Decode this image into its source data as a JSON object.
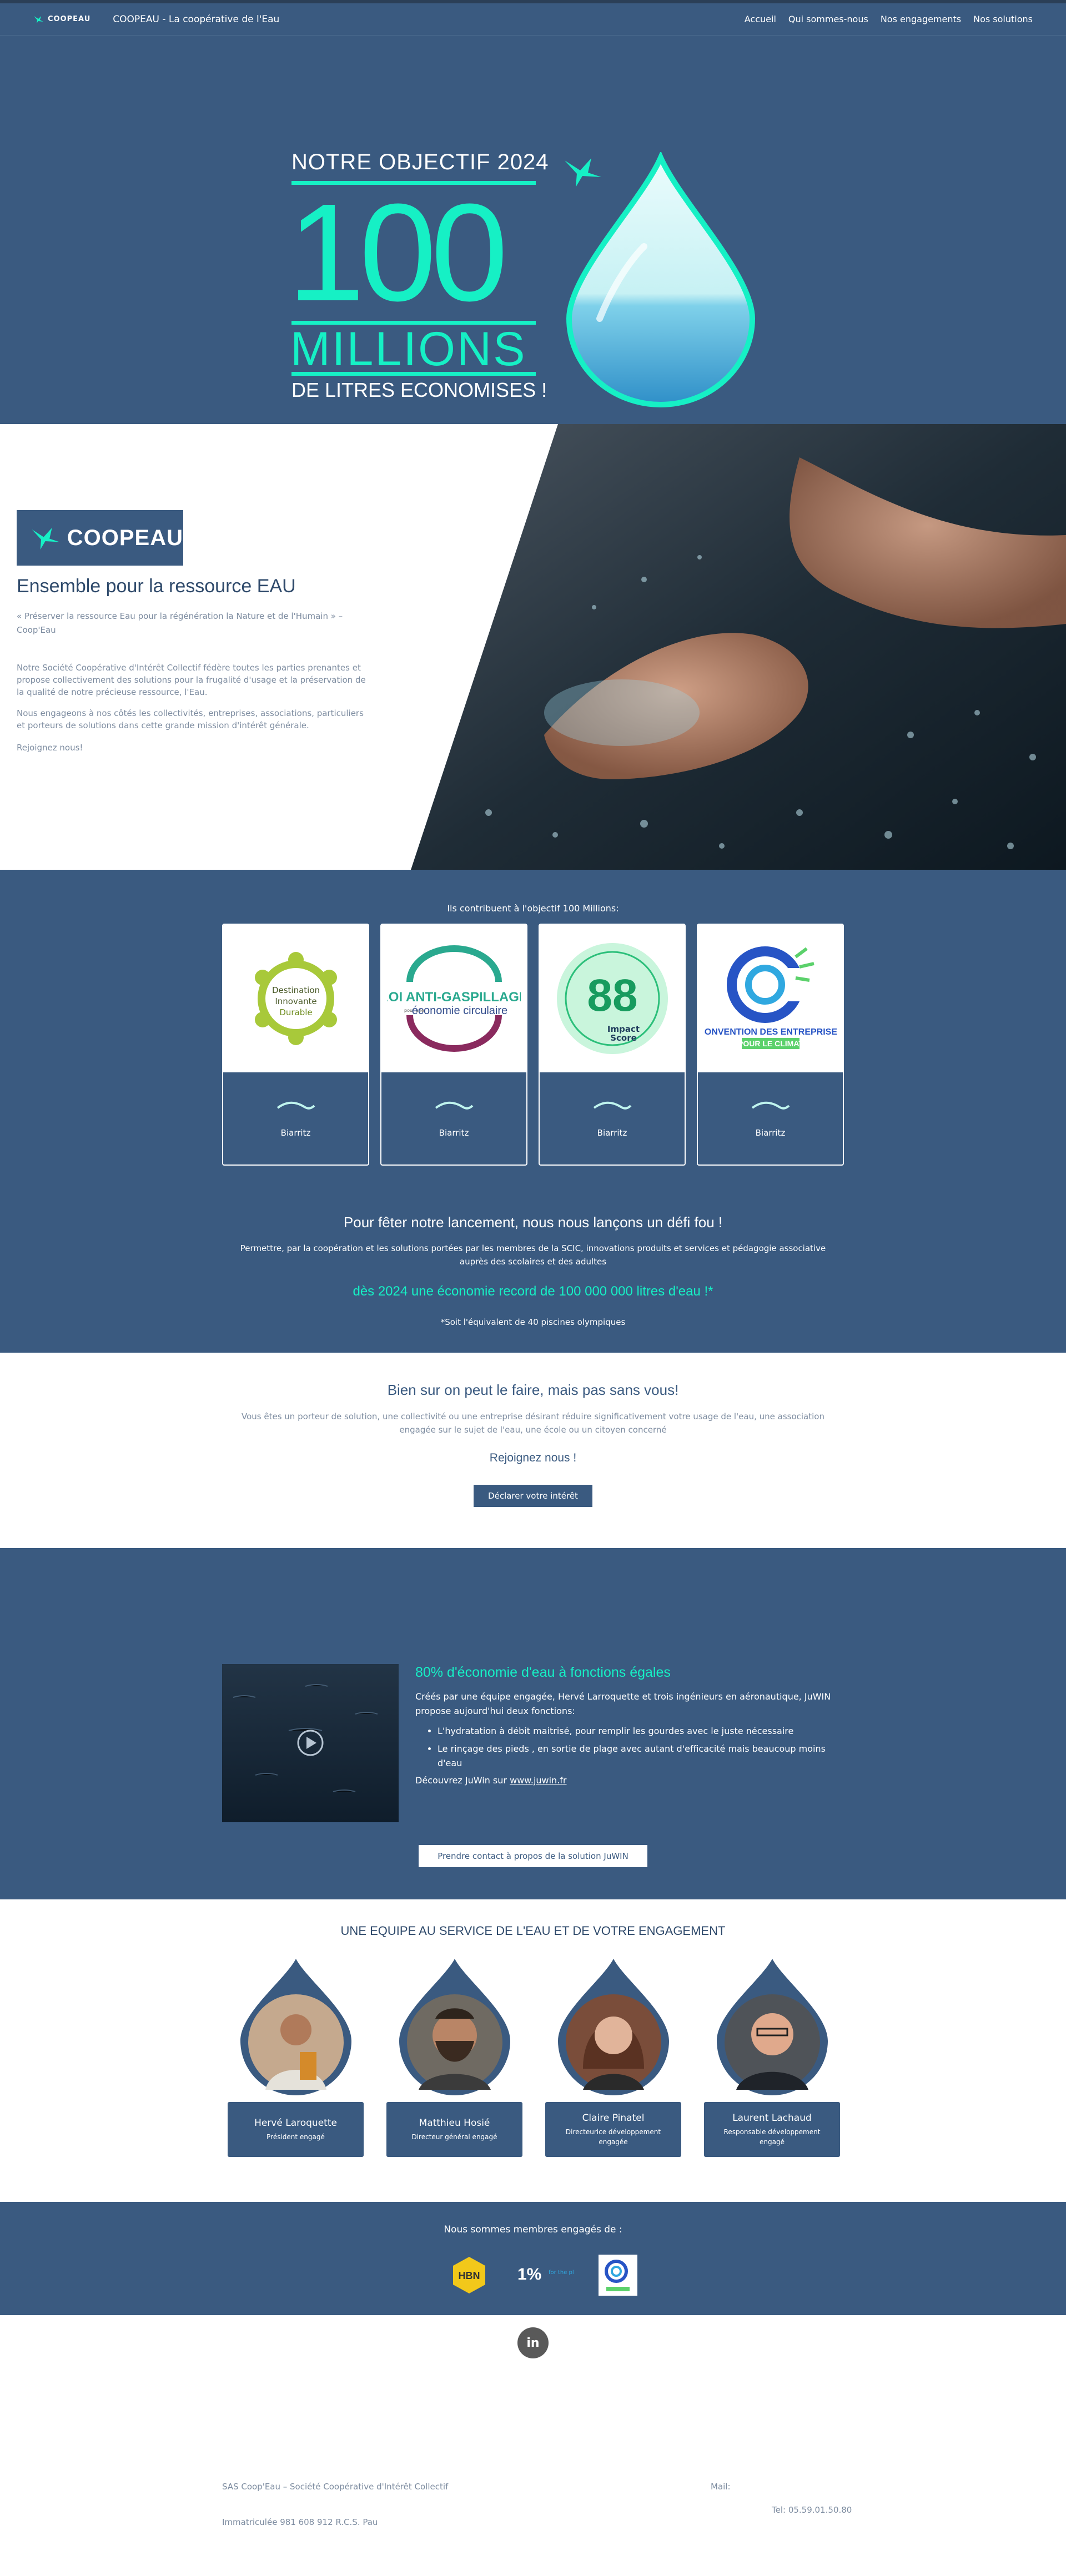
{
  "header": {
    "logo_text": "COOPEAU",
    "site_title": "COOPEAU - La coopérative de l'Eau",
    "menu": [
      "Accueil",
      "Qui sommes-nous",
      "Nos engagements",
      "Nos solutions"
    ]
  },
  "hero": {
    "objective": "NOTRE OBJECTIF 2024",
    "number": "100",
    "unit": "MILLIONS",
    "subtitle": "DE LITRES ECONOMISES !"
  },
  "ensemble": {
    "badge": "COOPEAU",
    "title": "Ensemble pour la ressource EAU",
    "quote": "« Préserver la ressource Eau pour la régénération la Nature et de l'Humain » – Coop'Eau",
    "p1": "Notre Société Coopérative d'Intérêt Collectif fédère toutes les parties prenantes et propose collectivement des solutions pour la frugalité d'usage et la préservation de la qualité de notre précieuse ressource, l'Eau.",
    "p2": "Nous engageons à nos côtés les collectivités, entreprises, associations, particuliers et porteurs de solutions dans cette grande mission d'intérêt générale.",
    "join": "Rejoignez nous!"
  },
  "contrib": {
    "title": "Ils contribuent à l'objectif 100 Millions:",
    "cards": [
      {
        "logo_line1": "Destination",
        "logo_line2": "Innovante",
        "logo_line3": "Durable",
        "city": "Biarritz"
      },
      {
        "logo_line1": "LOI ANTI-GASPILLAGE",
        "logo_line2": "économie circulaire",
        "logo_line3": "pour une",
        "city": "Biarritz"
      },
      {
        "logo_line1": "88",
        "logo_line2": "Impact",
        "logo_line3": "Score",
        "city": "Biarritz"
      },
      {
        "logo_line1": "CONVENTION DES ENTREPRISES",
        "logo_line2": "POUR LE CLIMAT",
        "logo_line3": "",
        "city": "Biarritz"
      }
    ],
    "defi_title": "Pour fêter notre lancement, nous nous lançons un défi fou !",
    "defi_text": "Permettre,  par la coopération et les solutions portées par les membres de la SCIC,  innovations produits et services et pédagogie associative auprès des scolaires et des adultes",
    "defi_goal": "dès 2024 une économie record de 100 000 000 litres d'eau !*",
    "defi_note": "*Soit l'équivalent de 40 piscines olympiques"
  },
  "join": {
    "title": "Bien sur on peut le faire, mais pas sans vous!",
    "text": "Vous êtes un porteur de solution, une collectivité ou une entreprise désirant réduire significativement votre usage de l'eau, une association engagée sur le sujet de l'eau, une école ou un citoyen concerné",
    "cta": "Rejoignez nous !",
    "button": "Déclarer votre intérêt"
  },
  "juwin": {
    "heading": "80% d'économie d'eau à fonctions égales",
    "intro": "Créés par une équipe engagée, Hervé Larroquette et trois ingénieurs en aéronautique, JuWIN propose aujourd'hui deux fonctions:",
    "bullets": [
      "L'hydratation à débit maitrisé, pour remplir les gourdes avec le juste nécessaire",
      "Le rinçage des pieds , en sortie de plage avec autant d'efficacité mais beaucoup moins d'eau"
    ],
    "link_prefix": "Découvrez JuWin sur ",
    "link_text": "www.juwin.fr",
    "button": "Prendre contact à propos de la solution JuWIN"
  },
  "team": {
    "title": "UNE EQUIPE AU SERVICE DE L'EAU ET DE VOTRE ENGAGEMENT",
    "members": [
      {
        "name": "Hervé Laroquette",
        "role": "Président engagé"
      },
      {
        "name": "Matthieu Hosié",
        "role": "Directeur général engagé"
      },
      {
        "name": "Claire Pinatel",
        "role": "Directeurice développement engagée"
      },
      {
        "name": "Laurent Lachaud",
        "role": "Responsable développement engagé"
      }
    ]
  },
  "partners": {
    "title": "Nous sommes membres engagés de :",
    "logos": [
      "HBN",
      "1%",
      "for the planet"
    ]
  },
  "footer": {
    "linkedin": "in",
    "company": "SAS Coop'Eau – Société Coopérative d'Intérêt Collectif",
    "registration": "Immatriculée 981 608 912 R.C.S. Pau",
    "mail": "Mail:",
    "tel": "Tel: 05.59.01.50.80"
  },
  "colors": {
    "navy": "#3a5a80",
    "accent": "#16f0c5"
  }
}
